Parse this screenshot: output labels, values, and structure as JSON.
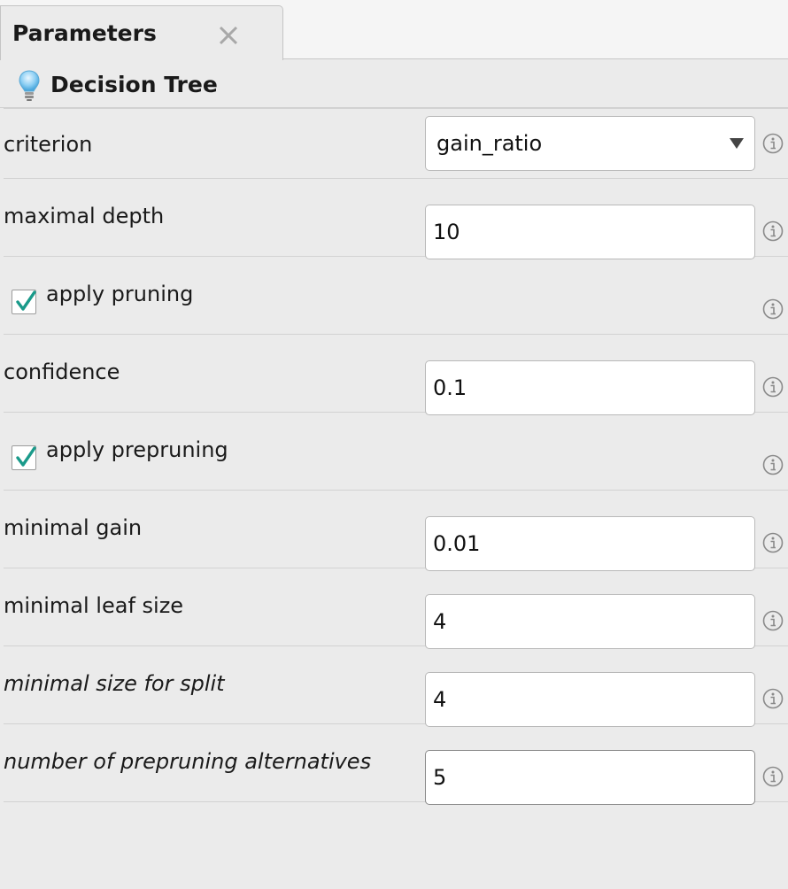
{
  "tab": {
    "label": "Parameters",
    "close_icon": "close-icon"
  },
  "operator": {
    "title": "Decision Tree",
    "icon": "lightbulb-icon"
  },
  "params": {
    "criterion": {
      "label": "criterion",
      "value": "gain_ratio"
    },
    "maximal_depth": {
      "label": "maximal depth",
      "value": "10"
    },
    "apply_pruning": {
      "label": "apply pruning",
      "checked": true
    },
    "confidence": {
      "label": "confidence",
      "value": "0.1"
    },
    "apply_prepruning": {
      "label": "apply prepruning",
      "checked": true
    },
    "minimal_gain": {
      "label": "minimal gain",
      "value": "0.01"
    },
    "minimal_leaf_size": {
      "label": "minimal leaf size",
      "value": "4"
    },
    "minimal_size_for_split": {
      "label": "minimal size for split",
      "value": "4"
    },
    "number_of_prepruning_alternatives": {
      "label": "number of prepruning alternatives",
      "value": "5"
    }
  },
  "colors": {
    "background": "#ebebeb",
    "check_mark": "#1a9a8a",
    "info_icon": "#8a8a8a"
  }
}
